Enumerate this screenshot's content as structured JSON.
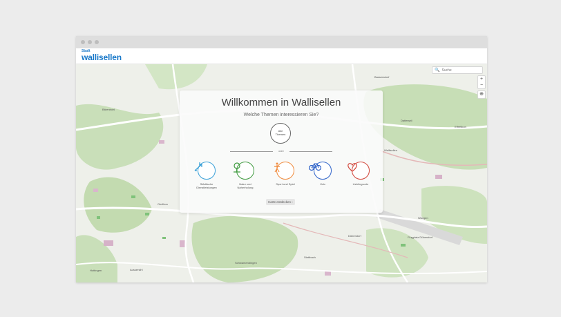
{
  "window": {
    "logo_small": "Stadt",
    "logo_main": "wallisellen"
  },
  "map": {
    "search_placeholder": "Suche",
    "search_icon": "search-icon",
    "zoom_in": "+",
    "zoom_out": "−",
    "locate_icon": "crosshair-icon",
    "labels": {
      "baerenbohl": "Bärenbohl",
      "bassersdorf": "Bassersdorf",
      "gutenwil": "Dattenwil",
      "wangen": "Wangen",
      "duebendorf": "Dübendorf",
      "stettbach": "Stettbach",
      "schwamendingen": "Schwamendingen",
      "pfaden": "Oerlikon",
      "wallisellen": "Wallisellen",
      "aussersihl": "Aussersihl",
      "hottingen": "Hottingen",
      "duebendorf_flugplatz": "Flugplatz Dübendorf",
      "effretikon": "Effretikon"
    }
  },
  "overlay": {
    "title": "Willkommen in Wallisellen",
    "subtitle": "Welche Themen interessieren Sie?",
    "all_topics_line1": "Alle",
    "all_topics_line2": "Themen",
    "or_label": "oder",
    "topics": [
      {
        "label": "Städtische Dienstleistungen",
        "icon": "crane-icon",
        "color": "#3aa0d8"
      },
      {
        "label": "Natur und Naherholung",
        "icon": "tree-icon",
        "color": "#3f9a3f"
      },
      {
        "label": "Sport und Spiel",
        "icon": "sport-icon",
        "color": "#f08a3c"
      },
      {
        "label": "Velo",
        "icon": "bicycle-icon",
        "color": "#2f63c9"
      },
      {
        "label": "Lieblingsorte",
        "icon": "heart-icon",
        "color": "#d2453a"
      }
    ],
    "button_label": "Karte entdecken"
  }
}
